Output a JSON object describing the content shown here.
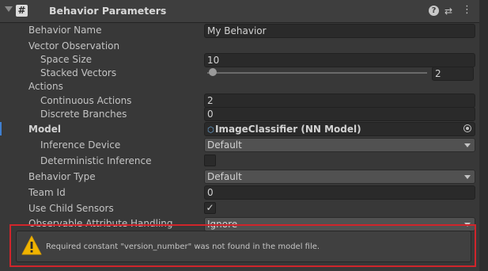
{
  "component": {
    "title": "Behavior Parameters",
    "help_icon": "help-icon",
    "preset_icon": "preset-icon",
    "menu_icon": "kebab-menu-icon"
  },
  "fields": {
    "behavior_name": {
      "label": "Behavior Name",
      "value": "My Behavior"
    },
    "vector_observation": {
      "label": "Vector Observation"
    },
    "space_size": {
      "label": "Space Size",
      "value": "10"
    },
    "stacked_vectors": {
      "label": "Stacked Vectors",
      "value": "2",
      "slider_fraction": 0.02
    },
    "actions": {
      "label": "Actions"
    },
    "continuous_actions": {
      "label": "Continuous Actions",
      "value": "2"
    },
    "discrete_branches": {
      "label": "Discrete Branches",
      "value": "0"
    },
    "model": {
      "label": "Model",
      "value": "ImageClassifier (NN Model)"
    },
    "inference_device": {
      "label": "Inference Device",
      "value": "Default"
    },
    "deterministic_inference": {
      "label": "Deterministic Inference",
      "checked": false
    },
    "behavior_type": {
      "label": "Behavior Type",
      "value": "Default"
    },
    "team_id": {
      "label": "Team Id",
      "value": "0"
    },
    "use_child_sensors": {
      "label": "Use Child Sensors",
      "checked": true,
      "check_glyph": "✓"
    },
    "observable_attribute_handling": {
      "label": "Observable Attribute Handling",
      "value": "Ignore"
    }
  },
  "warning": {
    "icon": "warning-icon",
    "message": "Required constant \"version_number\" was not found in the model file.",
    "icon_color": "#f0b400",
    "highlight_color": "#d0252b"
  }
}
